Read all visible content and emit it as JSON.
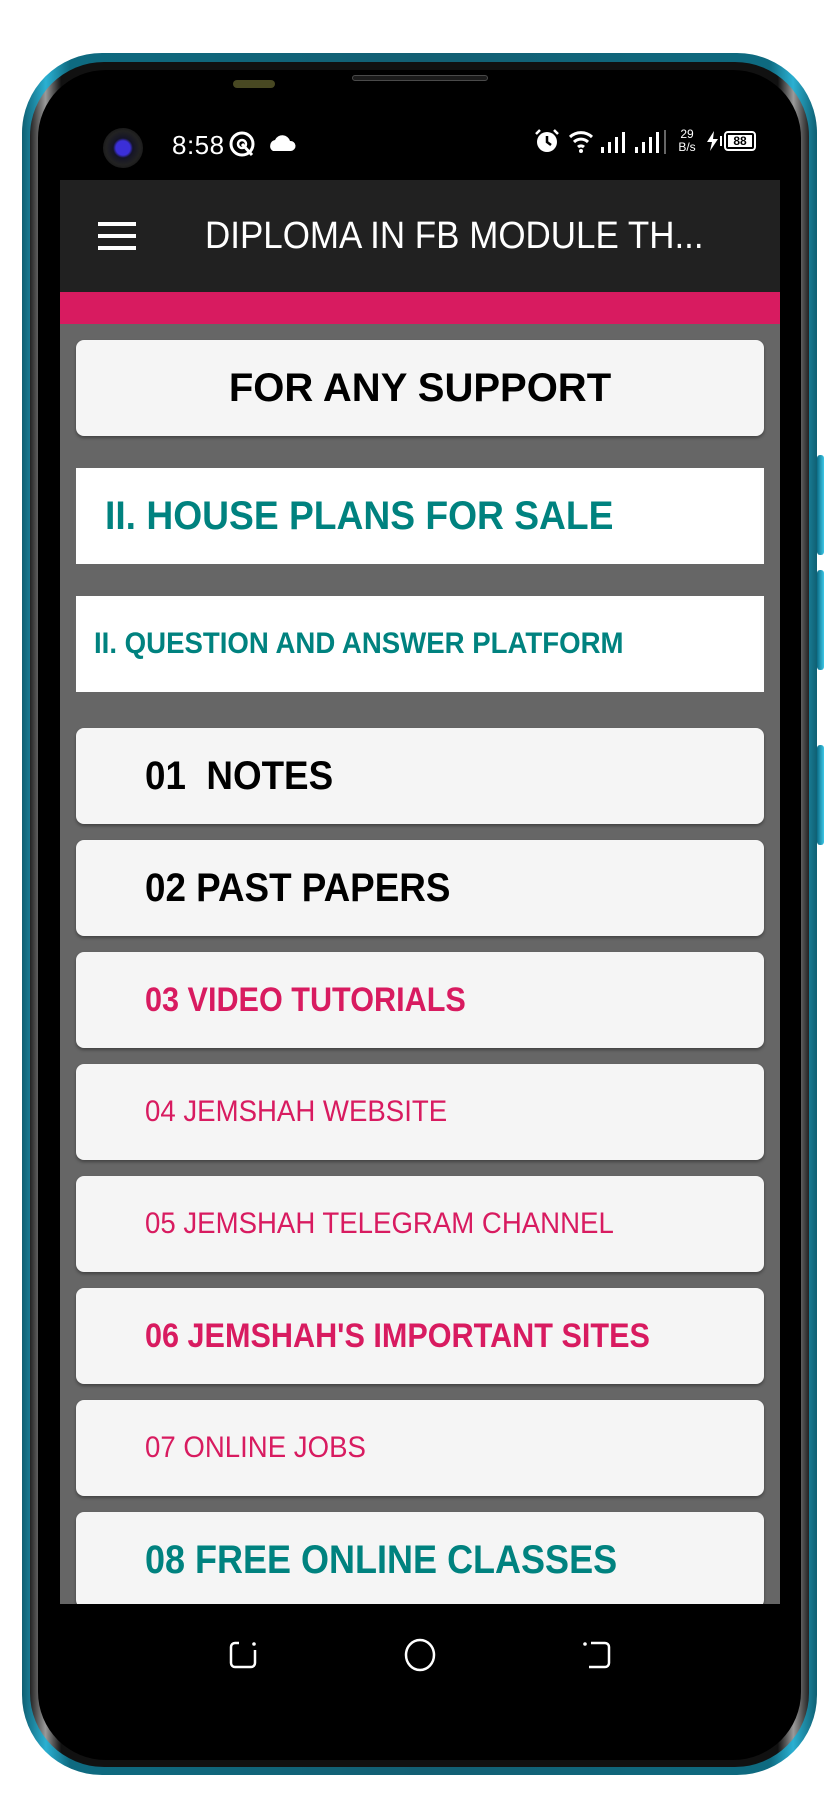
{
  "status_bar": {
    "time": "8:58",
    "net_speed_value": "29",
    "net_speed_unit": "B/s",
    "battery_level": "88",
    "icons": [
      "camera-punch-hole",
      "q-notification-icon",
      "cloud-icon",
      "alarm-icon",
      "wifi-icon",
      "signal-icon",
      "signal-icon",
      "charging-bolt-icon",
      "battery-icon"
    ]
  },
  "app_bar": {
    "menu_icon": "hamburger-menu-icon",
    "title": "DIPLOMA IN FB MODULE TH..."
  },
  "colors": {
    "app_bar": "#212121",
    "accent": "#d81b60",
    "teal": "#00827f",
    "pink": "#d81b60",
    "content_bg": "#666666",
    "card_bg": "#f5f5f5"
  },
  "menu": {
    "items": [
      {
        "label": "FOR ANY SUPPORT",
        "style": "bold-black-centered"
      },
      {
        "label": "II. HOUSE PLANS FOR SALE",
        "style": "bold-teal-large"
      },
      {
        "label": "II. QUESTION AND ANSWER PLATFORM",
        "style": "bold-teal-small"
      },
      {
        "label": "01  NOTES",
        "style": "bold-black"
      },
      {
        "label": "02 PAST PAPERS",
        "style": "bold-black"
      },
      {
        "label": "03 VIDEO TUTORIALS",
        "style": "bold-pink"
      },
      {
        "label": "04 JEMSHAH WEBSITE",
        "style": "regular-pink"
      },
      {
        "label": "05 JEMSHAH TELEGRAM CHANNEL",
        "style": "regular-pink"
      },
      {
        "label": "06 JEMSHAH'S IMPORTANT SITES",
        "style": "bold-pink"
      },
      {
        "label": "07 ONLINE JOBS",
        "style": "regular-pink"
      },
      {
        "label": "08 FREE ONLINE CLASSES",
        "style": "bold-teal"
      }
    ]
  },
  "nav_bar": {
    "buttons": [
      {
        "name": "recents-button",
        "icon": "recents-icon"
      },
      {
        "name": "home-button",
        "icon": "home-circle-icon"
      },
      {
        "name": "back-button",
        "icon": "back-icon"
      }
    ]
  }
}
